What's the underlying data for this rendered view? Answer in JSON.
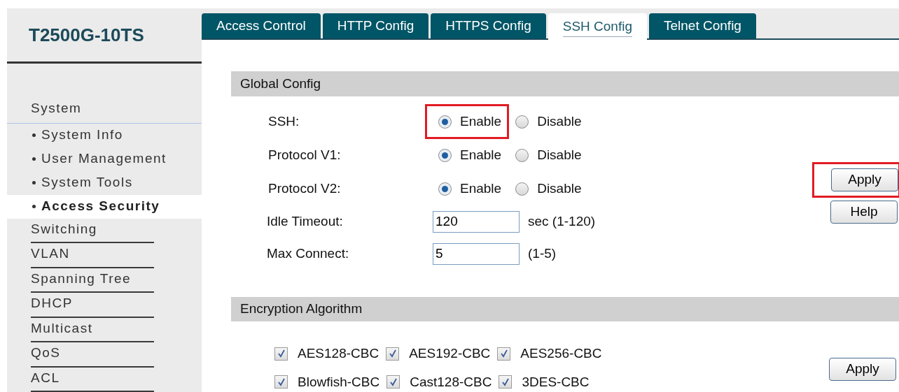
{
  "brand": "T2500G-10TS",
  "sidebar": {
    "items": [
      {
        "label": "System",
        "selected": false,
        "expanded": true,
        "children": [
          {
            "label": "System Info",
            "selected": false
          },
          {
            "label": "User Management",
            "selected": false
          },
          {
            "label": "System Tools",
            "selected": false
          },
          {
            "label": "Access Security",
            "selected": true
          }
        ]
      },
      {
        "label": "Switching",
        "selected": false,
        "expanded": false
      },
      {
        "label": "VLAN",
        "selected": false,
        "expanded": false
      },
      {
        "label": "Spanning Tree",
        "selected": false,
        "expanded": false
      },
      {
        "label": "DHCP",
        "selected": false,
        "expanded": false
      },
      {
        "label": "Multicast",
        "selected": false,
        "expanded": false
      },
      {
        "label": "QoS",
        "selected": false,
        "expanded": false
      },
      {
        "label": "ACL",
        "selected": false,
        "expanded": false
      }
    ]
  },
  "tabs": [
    {
      "label": "Access Control",
      "selected": false
    },
    {
      "label": "HTTP Config",
      "selected": false
    },
    {
      "label": "HTTPS Config",
      "selected": false
    },
    {
      "label": "SSH Config",
      "selected": true
    },
    {
      "label": "Telnet Config",
      "selected": false
    }
  ],
  "global_config": {
    "title": "Global Config",
    "rows": [
      {
        "kind": "radio",
        "label": "SSH:",
        "options": [
          {
            "label": "Enable",
            "selected": true,
            "highlighted": true
          },
          {
            "label": "Disable",
            "selected": false,
            "highlighted": false
          }
        ]
      },
      {
        "kind": "radio",
        "label": "Protocol V1:",
        "options": [
          {
            "label": "Enable",
            "selected": true,
            "highlighted": false
          },
          {
            "label": "Disable",
            "selected": false,
            "highlighted": false
          }
        ]
      },
      {
        "kind": "radio",
        "label": "Protocol V2:",
        "options": [
          {
            "label": "Enable",
            "selected": true,
            "highlighted": false
          },
          {
            "label": "Disable",
            "selected": false,
            "highlighted": false
          }
        ]
      },
      {
        "kind": "input",
        "label": "Idle Timeout:",
        "value": "120",
        "hint": "sec (1-120)"
      },
      {
        "kind": "input",
        "label": "Max Connect:",
        "value": "5",
        "hint": "(1-5)"
      }
    ],
    "buttons": [
      {
        "label": "Apply",
        "highlighted": true
      },
      {
        "label": "Help",
        "highlighted": false
      }
    ]
  },
  "encryption": {
    "title": "Encryption Algorithm",
    "rows": [
      [
        {
          "label": "AES128-CBC",
          "checked": true
        },
        {
          "label": "AES192-CBC",
          "checked": true
        },
        {
          "label": "AES256-CBC",
          "checked": true
        }
      ],
      [
        {
          "label": "Blowfish-CBC",
          "checked": true
        },
        {
          "label": "Cast128-CBC",
          "checked": true
        },
        {
          "label": "3DES-CBC",
          "checked": true
        }
      ]
    ],
    "buttons": [
      {
        "label": "Apply",
        "highlighted": false
      }
    ]
  }
}
